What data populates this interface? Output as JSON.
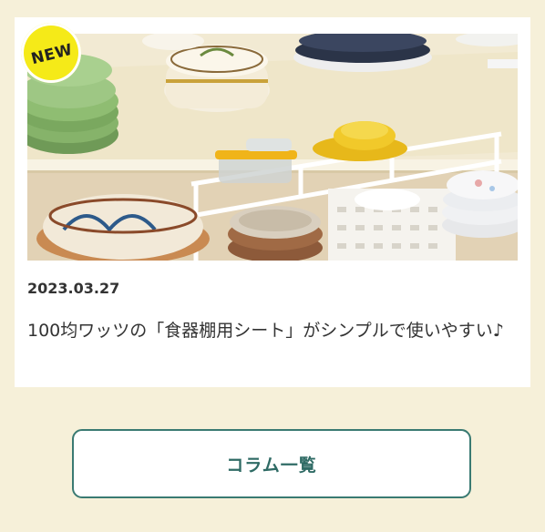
{
  "article": {
    "badge": "NEW",
    "date": "2023.03.27",
    "title": "100均ワッツの「食器棚用シート」がシンプルで使いやすい♪",
    "image_alt": "食器棚の棚に並んだ食器とワイヤーラック"
  },
  "more_button": {
    "label": "コラム一覧"
  },
  "colors": {
    "page_background": "#f6f0d9",
    "card_background": "#ffffff",
    "badge": "#f5ea18",
    "button_border": "#3a7a72",
    "button_text": "#2f6b65",
    "text": "#333333"
  }
}
